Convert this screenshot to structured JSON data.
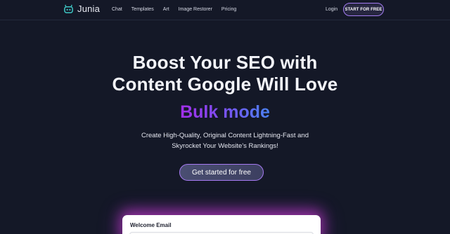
{
  "nav": {
    "brand": "Junia",
    "links": [
      "Chat",
      "Templates",
      "Art",
      "Image Restorer",
      "Pricing"
    ],
    "login": "Login",
    "start": "START FOR FREE"
  },
  "hero": {
    "headline_line1": "Boost Your SEO with",
    "headline_line2": "Content Google Will Love",
    "mode": "Bulk mode",
    "sub_line1": "Create High-Quality, Original Content Lightning-Fast and",
    "sub_line2": "Skyrocket Your Website's Rankings!",
    "cta": "Get started for free"
  },
  "card": {
    "label": "Welcome Email"
  },
  "colors": {
    "background": "#141827",
    "accent_border": "#a67af2",
    "gradient_start": "#a32ee8",
    "gradient_end": "#4a82f4"
  }
}
